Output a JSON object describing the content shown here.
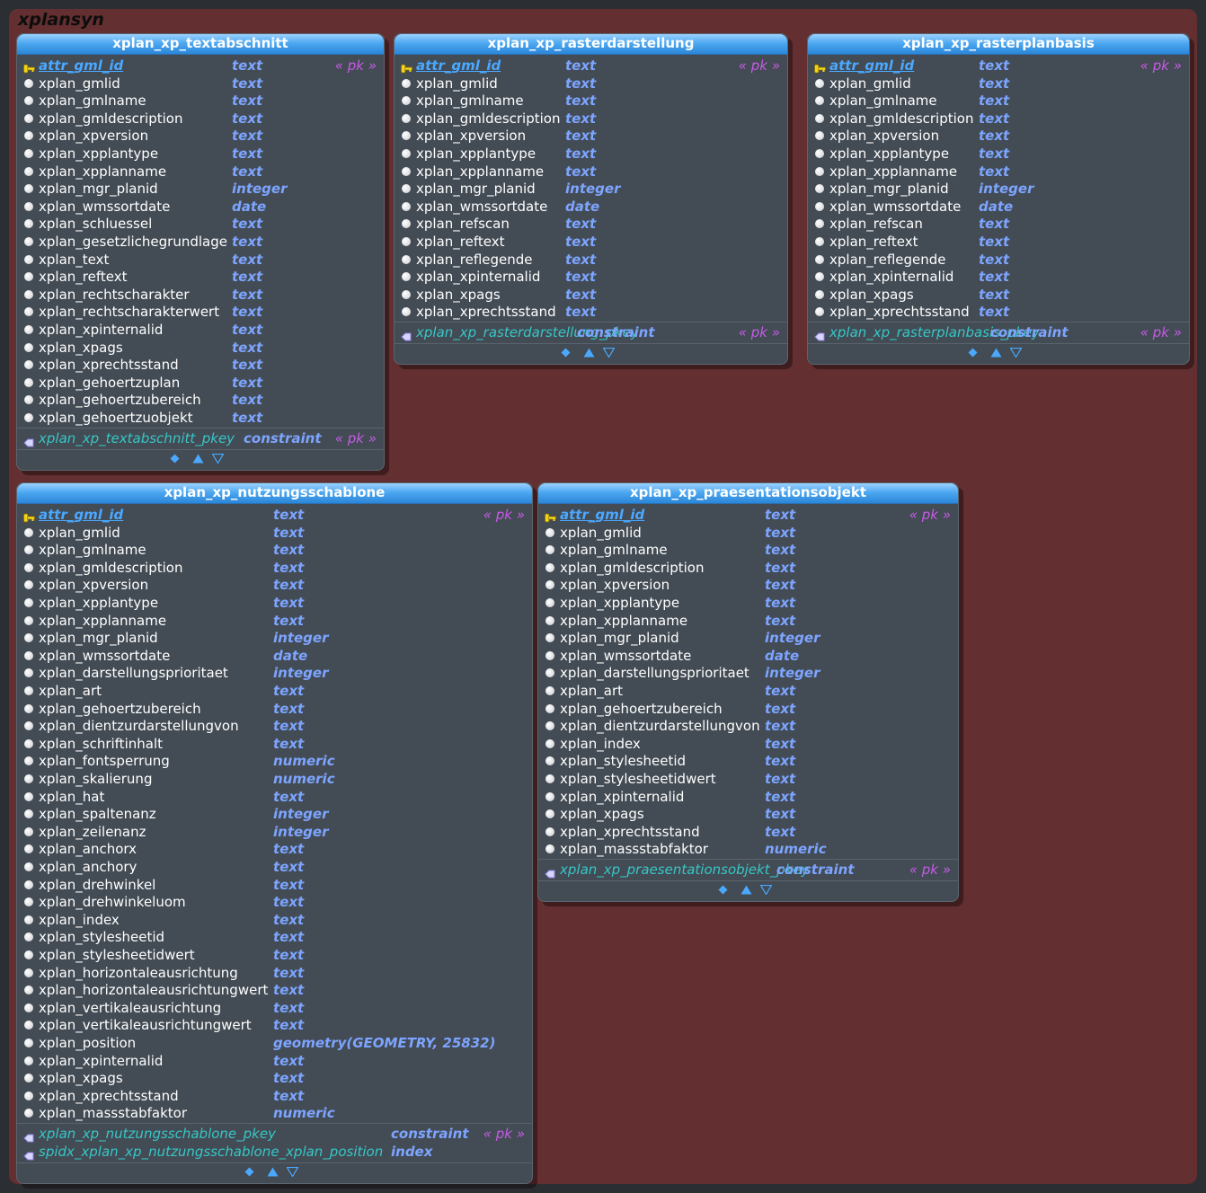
{
  "schema": {
    "name": "xplansyn"
  },
  "tables": [
    {
      "id": "textabschnitt",
      "name": "xplan_xp_textabschnitt",
      "columns": [
        {
          "name": "attr_gml_id",
          "type": "text",
          "pk": true,
          "tag": "« pk »"
        },
        {
          "name": "xplan_gmlid",
          "type": "text"
        },
        {
          "name": "xplan_gmlname",
          "type": "text"
        },
        {
          "name": "xplan_gmldescription",
          "type": "text"
        },
        {
          "name": "xplan_xpversion",
          "type": "text"
        },
        {
          "name": "xplan_xpplantype",
          "type": "text"
        },
        {
          "name": "xplan_xpplanname",
          "type": "text"
        },
        {
          "name": "xplan_mgr_planid",
          "type": "integer"
        },
        {
          "name": "xplan_wmssortdate",
          "type": "date"
        },
        {
          "name": "xplan_schluessel",
          "type": "text"
        },
        {
          "name": "xplan_gesetzlichegrundlage",
          "type": "text"
        },
        {
          "name": "xplan_text",
          "type": "text"
        },
        {
          "name": "xplan_reftext",
          "type": "text"
        },
        {
          "name": "xplan_rechtscharakter",
          "type": "text"
        },
        {
          "name": "xplan_rechtscharakterwert",
          "type": "text"
        },
        {
          "name": "xplan_xpinternalid",
          "type": "text"
        },
        {
          "name": "xplan_xpags",
          "type": "text"
        },
        {
          "name": "xplan_xprechtsstand",
          "type": "text"
        },
        {
          "name": "xplan_gehoertzuplan",
          "type": "text"
        },
        {
          "name": "xplan_gehoertzubereich",
          "type": "text"
        },
        {
          "name": "xplan_gehoertzuobjekt",
          "type": "text"
        }
      ],
      "constraints": [
        {
          "name": "xplan_xp_textabschnitt_pkey",
          "type": "constraint",
          "tag": "« pk »"
        }
      ]
    },
    {
      "id": "rasterdarstellung",
      "name": "xplan_xp_rasterdarstellung",
      "columns": [
        {
          "name": "attr_gml_id",
          "type": "text",
          "pk": true,
          "tag": "« pk »"
        },
        {
          "name": "xplan_gmlid",
          "type": "text"
        },
        {
          "name": "xplan_gmlname",
          "type": "text"
        },
        {
          "name": "xplan_gmldescription",
          "type": "text"
        },
        {
          "name": "xplan_xpversion",
          "type": "text"
        },
        {
          "name": "xplan_xpplantype",
          "type": "text"
        },
        {
          "name": "xplan_xpplanname",
          "type": "text"
        },
        {
          "name": "xplan_mgr_planid",
          "type": "integer"
        },
        {
          "name": "xplan_wmssortdate",
          "type": "date"
        },
        {
          "name": "xplan_refscan",
          "type": "text"
        },
        {
          "name": "xplan_reftext",
          "type": "text"
        },
        {
          "name": "xplan_reflegende",
          "type": "text"
        },
        {
          "name": "xplan_xpinternalid",
          "type": "text"
        },
        {
          "name": "xplan_xpags",
          "type": "text"
        },
        {
          "name": "xplan_xprechtsstand",
          "type": "text"
        }
      ],
      "constraints": [
        {
          "name": "xplan_xp_rasterdarstellung_pkey",
          "type": "constraint",
          "tag": "« pk »"
        }
      ]
    },
    {
      "id": "rasterplanbasis",
      "name": "xplan_xp_rasterplanbasis",
      "columns": [
        {
          "name": "attr_gml_id",
          "type": "text",
          "pk": true,
          "tag": "« pk »"
        },
        {
          "name": "xplan_gmlid",
          "type": "text"
        },
        {
          "name": "xplan_gmlname",
          "type": "text"
        },
        {
          "name": "xplan_gmldescription",
          "type": "text"
        },
        {
          "name": "xplan_xpversion",
          "type": "text"
        },
        {
          "name": "xplan_xpplantype",
          "type": "text"
        },
        {
          "name": "xplan_xpplanname",
          "type": "text"
        },
        {
          "name": "xplan_mgr_planid",
          "type": "integer"
        },
        {
          "name": "xplan_wmssortdate",
          "type": "date"
        },
        {
          "name": "xplan_refscan",
          "type": "text"
        },
        {
          "name": "xplan_reftext",
          "type": "text"
        },
        {
          "name": "xplan_reflegende",
          "type": "text"
        },
        {
          "name": "xplan_xpinternalid",
          "type": "text"
        },
        {
          "name": "xplan_xpags",
          "type": "text"
        },
        {
          "name": "xplan_xprechtsstand",
          "type": "text"
        }
      ],
      "constraints": [
        {
          "name": "xplan_xp_rasterplanbasis_pkey",
          "type": "constraint",
          "tag": "« pk »"
        }
      ]
    },
    {
      "id": "nutzungsschablone",
      "name": "xplan_xp_nutzungsschablone",
      "columns": [
        {
          "name": "attr_gml_id",
          "type": "text",
          "pk": true,
          "tag": "« pk »"
        },
        {
          "name": "xplan_gmlid",
          "type": "text"
        },
        {
          "name": "xplan_gmlname",
          "type": "text"
        },
        {
          "name": "xplan_gmldescription",
          "type": "text"
        },
        {
          "name": "xplan_xpversion",
          "type": "text"
        },
        {
          "name": "xplan_xpplantype",
          "type": "text"
        },
        {
          "name": "xplan_xpplanname",
          "type": "text"
        },
        {
          "name": "xplan_mgr_planid",
          "type": "integer"
        },
        {
          "name": "xplan_wmssortdate",
          "type": "date"
        },
        {
          "name": "xplan_darstellungsprioritaet",
          "type": "integer"
        },
        {
          "name": "xplan_art",
          "type": "text"
        },
        {
          "name": "xplan_gehoertzubereich",
          "type": "text"
        },
        {
          "name": "xplan_dientzurdarstellungvon",
          "type": "text"
        },
        {
          "name": "xplan_schriftinhalt",
          "type": "text"
        },
        {
          "name": "xplan_fontsperrung",
          "type": "numeric"
        },
        {
          "name": "xplan_skalierung",
          "type": "numeric"
        },
        {
          "name": "xplan_hat",
          "type": "text"
        },
        {
          "name": "xplan_spaltenanz",
          "type": "integer"
        },
        {
          "name": "xplan_zeilenanz",
          "type": "integer"
        },
        {
          "name": "xplan_anchorx",
          "type": "text"
        },
        {
          "name": "xplan_anchory",
          "type": "text"
        },
        {
          "name": "xplan_drehwinkel",
          "type": "text"
        },
        {
          "name": "xplan_drehwinkeluom",
          "type": "text"
        },
        {
          "name": "xplan_index",
          "type": "text"
        },
        {
          "name": "xplan_stylesheetid",
          "type": "text"
        },
        {
          "name": "xplan_stylesheetidwert",
          "type": "text"
        },
        {
          "name": "xplan_horizontaleausrichtung",
          "type": "text"
        },
        {
          "name": "xplan_horizontaleausrichtungwert",
          "type": "text"
        },
        {
          "name": "xplan_vertikaleausrichtung",
          "type": "text"
        },
        {
          "name": "xplan_vertikaleausrichtungwert",
          "type": "text"
        },
        {
          "name": "xplan_position",
          "type": "geometry(GEOMETRY, 25832)"
        },
        {
          "name": "xplan_xpinternalid",
          "type": "text"
        },
        {
          "name": "xplan_xpags",
          "type": "text"
        },
        {
          "name": "xplan_xprechtsstand",
          "type": "text"
        },
        {
          "name": "xplan_massstabfaktor",
          "type": "numeric"
        }
      ],
      "constraints": [
        {
          "name": "xplan_xp_nutzungsschablone_pkey",
          "type": "constraint",
          "tag": "« pk »"
        },
        {
          "name": "spidx_xplan_xp_nutzungsschablone_xplan_position",
          "type": "index",
          "tag": ""
        }
      ]
    },
    {
      "id": "praesentationsobjekt",
      "name": "xplan_xp_praesentationsobjekt",
      "columns": [
        {
          "name": "attr_gml_id",
          "type": "text",
          "pk": true,
          "tag": "« pk »"
        },
        {
          "name": "xplan_gmlid",
          "type": "text"
        },
        {
          "name": "xplan_gmlname",
          "type": "text"
        },
        {
          "name": "xplan_gmldescription",
          "type": "text"
        },
        {
          "name": "xplan_xpversion",
          "type": "text"
        },
        {
          "name": "xplan_xpplantype",
          "type": "text"
        },
        {
          "name": "xplan_xpplanname",
          "type": "text"
        },
        {
          "name": "xplan_mgr_planid",
          "type": "integer"
        },
        {
          "name": "xplan_wmssortdate",
          "type": "date"
        },
        {
          "name": "xplan_darstellungsprioritaet",
          "type": "integer"
        },
        {
          "name": "xplan_art",
          "type": "text"
        },
        {
          "name": "xplan_gehoertzubereich",
          "type": "text"
        },
        {
          "name": "xplan_dientzurdarstellungvon",
          "type": "text"
        },
        {
          "name": "xplan_index",
          "type": "text"
        },
        {
          "name": "xplan_stylesheetid",
          "type": "text"
        },
        {
          "name": "xplan_stylesheetidwert",
          "type": "text"
        },
        {
          "name": "xplan_xpinternalid",
          "type": "text"
        },
        {
          "name": "xplan_xpags",
          "type": "text"
        },
        {
          "name": "xplan_xprechtsstand",
          "type": "text"
        },
        {
          "name": "xplan_massstabfaktor",
          "type": "numeric"
        }
      ],
      "constraints": [
        {
          "name": "xplan_xp_praesentationsobjekt_pkey",
          "type": "constraint",
          "tag": "« pk »"
        }
      ]
    }
  ],
  "colors": {
    "schema_bg": "#632f30",
    "table_bg": "#434b54",
    "header_blue": "#4ea8f1",
    "pk_name": "#4aa8ff",
    "type": "#7da5ff",
    "tag": "#c65be7",
    "constraint_name": "#37c7c7"
  },
  "icons": {
    "pk_column": "key-icon",
    "column": "column-bullet-icon",
    "constraint": "constraint-icon",
    "nav": [
      "diamond-icon",
      "triangle-up-icon",
      "triangle-down-icon"
    ]
  }
}
